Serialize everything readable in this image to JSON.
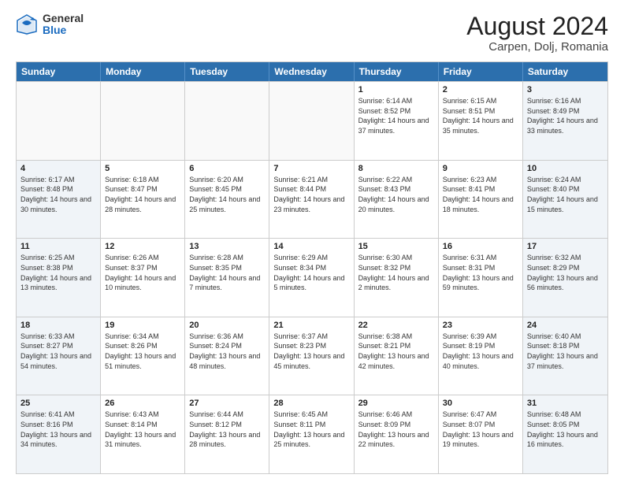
{
  "logo": {
    "general": "General",
    "blue": "Blue"
  },
  "title": "August 2024",
  "subtitle": "Carpen, Dolj, Romania",
  "days": [
    "Sunday",
    "Monday",
    "Tuesday",
    "Wednesday",
    "Thursday",
    "Friday",
    "Saturday"
  ],
  "weeks": [
    [
      {
        "day": "",
        "info": ""
      },
      {
        "day": "",
        "info": ""
      },
      {
        "day": "",
        "info": ""
      },
      {
        "day": "",
        "info": ""
      },
      {
        "day": "1",
        "info": "Sunrise: 6:14 AM\nSunset: 8:52 PM\nDaylight: 14 hours and 37 minutes."
      },
      {
        "day": "2",
        "info": "Sunrise: 6:15 AM\nSunset: 8:51 PM\nDaylight: 14 hours and 35 minutes."
      },
      {
        "day": "3",
        "info": "Sunrise: 6:16 AM\nSunset: 8:49 PM\nDaylight: 14 hours and 33 minutes."
      }
    ],
    [
      {
        "day": "4",
        "info": "Sunrise: 6:17 AM\nSunset: 8:48 PM\nDaylight: 14 hours and 30 minutes."
      },
      {
        "day": "5",
        "info": "Sunrise: 6:18 AM\nSunset: 8:47 PM\nDaylight: 14 hours and 28 minutes."
      },
      {
        "day": "6",
        "info": "Sunrise: 6:20 AM\nSunset: 8:45 PM\nDaylight: 14 hours and 25 minutes."
      },
      {
        "day": "7",
        "info": "Sunrise: 6:21 AM\nSunset: 8:44 PM\nDaylight: 14 hours and 23 minutes."
      },
      {
        "day": "8",
        "info": "Sunrise: 6:22 AM\nSunset: 8:43 PM\nDaylight: 14 hours and 20 minutes."
      },
      {
        "day": "9",
        "info": "Sunrise: 6:23 AM\nSunset: 8:41 PM\nDaylight: 14 hours and 18 minutes."
      },
      {
        "day": "10",
        "info": "Sunrise: 6:24 AM\nSunset: 8:40 PM\nDaylight: 14 hours and 15 minutes."
      }
    ],
    [
      {
        "day": "11",
        "info": "Sunrise: 6:25 AM\nSunset: 8:38 PM\nDaylight: 14 hours and 13 minutes."
      },
      {
        "day": "12",
        "info": "Sunrise: 6:26 AM\nSunset: 8:37 PM\nDaylight: 14 hours and 10 minutes."
      },
      {
        "day": "13",
        "info": "Sunrise: 6:28 AM\nSunset: 8:35 PM\nDaylight: 14 hours and 7 minutes."
      },
      {
        "day": "14",
        "info": "Sunrise: 6:29 AM\nSunset: 8:34 PM\nDaylight: 14 hours and 5 minutes."
      },
      {
        "day": "15",
        "info": "Sunrise: 6:30 AM\nSunset: 8:32 PM\nDaylight: 14 hours and 2 minutes."
      },
      {
        "day": "16",
        "info": "Sunrise: 6:31 AM\nSunset: 8:31 PM\nDaylight: 13 hours and 59 minutes."
      },
      {
        "day": "17",
        "info": "Sunrise: 6:32 AM\nSunset: 8:29 PM\nDaylight: 13 hours and 56 minutes."
      }
    ],
    [
      {
        "day": "18",
        "info": "Sunrise: 6:33 AM\nSunset: 8:27 PM\nDaylight: 13 hours and 54 minutes."
      },
      {
        "day": "19",
        "info": "Sunrise: 6:34 AM\nSunset: 8:26 PM\nDaylight: 13 hours and 51 minutes."
      },
      {
        "day": "20",
        "info": "Sunrise: 6:36 AM\nSunset: 8:24 PM\nDaylight: 13 hours and 48 minutes."
      },
      {
        "day": "21",
        "info": "Sunrise: 6:37 AM\nSunset: 8:23 PM\nDaylight: 13 hours and 45 minutes."
      },
      {
        "day": "22",
        "info": "Sunrise: 6:38 AM\nSunset: 8:21 PM\nDaylight: 13 hours and 42 minutes."
      },
      {
        "day": "23",
        "info": "Sunrise: 6:39 AM\nSunset: 8:19 PM\nDaylight: 13 hours and 40 minutes."
      },
      {
        "day": "24",
        "info": "Sunrise: 6:40 AM\nSunset: 8:18 PM\nDaylight: 13 hours and 37 minutes."
      }
    ],
    [
      {
        "day": "25",
        "info": "Sunrise: 6:41 AM\nSunset: 8:16 PM\nDaylight: 13 hours and 34 minutes."
      },
      {
        "day": "26",
        "info": "Sunrise: 6:43 AM\nSunset: 8:14 PM\nDaylight: 13 hours and 31 minutes."
      },
      {
        "day": "27",
        "info": "Sunrise: 6:44 AM\nSunset: 8:12 PM\nDaylight: 13 hours and 28 minutes."
      },
      {
        "day": "28",
        "info": "Sunrise: 6:45 AM\nSunset: 8:11 PM\nDaylight: 13 hours and 25 minutes."
      },
      {
        "day": "29",
        "info": "Sunrise: 6:46 AM\nSunset: 8:09 PM\nDaylight: 13 hours and 22 minutes."
      },
      {
        "day": "30",
        "info": "Sunrise: 6:47 AM\nSunset: 8:07 PM\nDaylight: 13 hours and 19 minutes."
      },
      {
        "day": "31",
        "info": "Sunrise: 6:48 AM\nSunset: 8:05 PM\nDaylight: 13 hours and 16 minutes."
      }
    ]
  ]
}
